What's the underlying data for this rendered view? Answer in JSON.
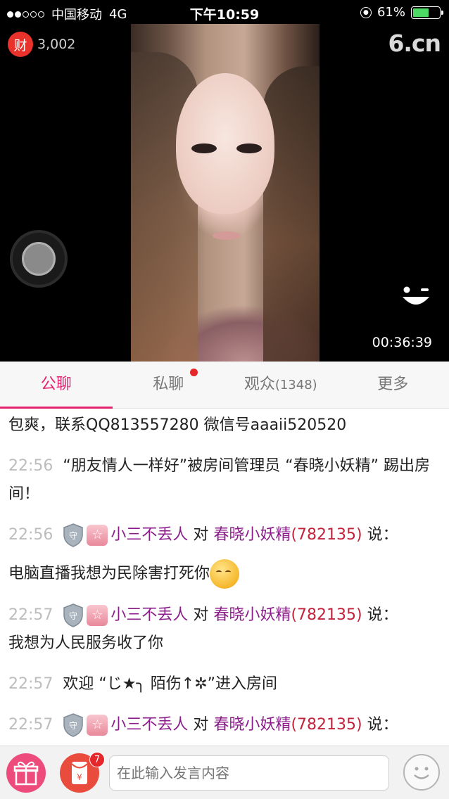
{
  "status_bar": {
    "carrier": "中国移动",
    "network": "4G",
    "time": "下午10:59",
    "battery_percent": "61%",
    "battery_level": 0.61,
    "signal_bars": 2
  },
  "video": {
    "coin_label": "财",
    "coin_count": "3,002",
    "logo": "6.cn",
    "elapsed": "00:36:39"
  },
  "tabs": [
    {
      "label": "公聊",
      "active": true
    },
    {
      "label": "私聊",
      "active": false,
      "has_dot": true
    },
    {
      "label": "观众",
      "count": "(1348)",
      "active": false
    },
    {
      "label": "更多",
      "active": false
    }
  ],
  "chat": {
    "m0": {
      "text": "包爽，联系QQ813557280 微信号aaaii520520"
    },
    "m1": {
      "time": "22:56",
      "text": "“朋友情人一样好”被房间管理员 “春晓小妖精” 踢出房间！"
    },
    "m2": {
      "time": "22:56",
      "guard": "守",
      "star": "☆",
      "name": "小三不丢人",
      "to": "对",
      "target": "春晓小妖精",
      "target_id": "(782135)",
      "says": "说：",
      "text": "电脑直播我想为民除害打死你"
    },
    "m3": {
      "time": "22:57",
      "guard": "守",
      "star": "☆",
      "name": "小三不丢人",
      "to": "对",
      "target": "春晓小妖精",
      "target_id": "(782135)",
      "says": "说：",
      "text": "我想为人民服务收了你"
    },
    "m4": {
      "time": "22:57",
      "text": "欢迎 “じ★╮ 陌伤↑✲”进入房间"
    },
    "m5": {
      "time": "22:57",
      "guard": "守",
      "star": "☆",
      "name": "小三不丢人",
      "to": "对",
      "target": "春晓小妖精",
      "target_id": "(782135)",
      "says": "说："
    }
  },
  "bottom": {
    "redpack_badge": "7",
    "input_placeholder": "在此输入发言内容"
  },
  "colors": {
    "accent": "#e5226e",
    "username": "#8a1d8a",
    "user_id": "#c2233a",
    "timestamp": "#bdbdbd"
  }
}
